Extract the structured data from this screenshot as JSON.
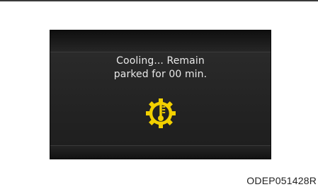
{
  "display": {
    "message_line1": "Cooling... Remain",
    "message_line2": "parked for 00 min.",
    "warning_icon": "transmission-temperature-warning-icon",
    "icon_color": "#f2d000"
  },
  "caption": "ODEP051428R"
}
